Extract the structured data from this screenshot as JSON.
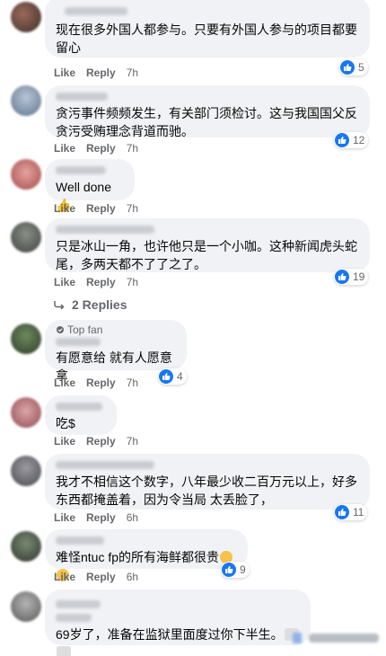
{
  "action_labels": {
    "like": "Like",
    "reply": "Reply"
  },
  "comments": [
    {
      "text": "现在很多外国人都参与。只要有外国人参与的项目都要留心",
      "time": "7h",
      "reactions": "5"
    },
    {
      "text": "贪污事件频频发生，有关部门须检讨。这与我国国父反贪污受贿理念背道而驰。",
      "time": "7h",
      "reactions": "12"
    },
    {
      "text": "Well done 👍",
      "time": "7h",
      "reactions": ""
    },
    {
      "text": "只是冰山一角，也许他只是一个小咖。这种新闻虎头蛇尾，多两天都不了了之了。",
      "time": "7h",
      "reactions": "19",
      "replies": "2 Replies"
    },
    {
      "badge": "Top fan",
      "text": "有愿意给 就有人愿意拿",
      "time": "7h",
      "reactions": "4"
    },
    {
      "text": "吃$",
      "time": "7h",
      "reactions": ""
    },
    {
      "text": "我才不相信这个数字，八年最少收二百万元以上，好多东西都掩盖着，因为令当局 太丢脸了，",
      "time": "6h",
      "reactions": "11"
    },
    {
      "text": "难怪ntuc fp的所有海鲜都很贵",
      "time": "6h",
      "reactions": "9"
    },
    {
      "text": "69岁了，准备在监狱里面度过你下半生。",
      "time": "",
      "reactions": ""
    }
  ]
}
